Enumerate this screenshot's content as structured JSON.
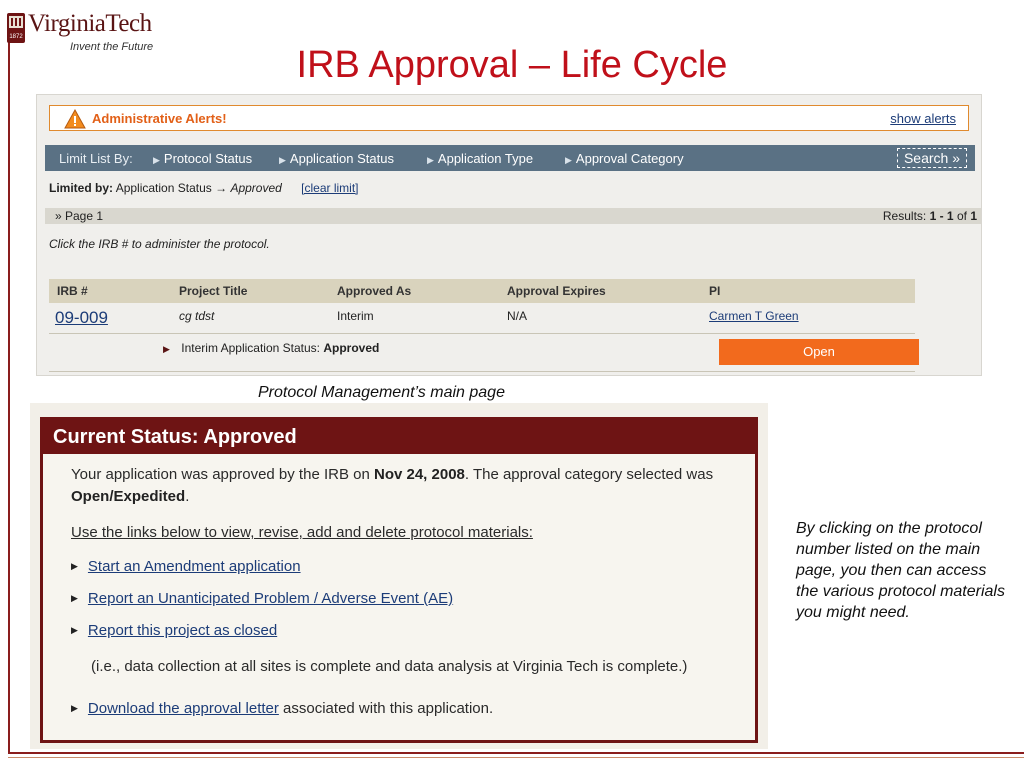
{
  "logo": {
    "wordmark": "VirginiaTech",
    "tagline": "Invent the Future",
    "seal_text": "1872"
  },
  "slide": {
    "title": "IRB Approval – Life Cycle"
  },
  "alerts": {
    "label": "Administrative Alerts!",
    "show_link": "show alerts",
    "icon": "warning-triangle-icon"
  },
  "limit_bar": {
    "label": "Limit List By:",
    "filters": [
      "Protocol Status",
      "Application Status",
      "Application Type",
      "Approval Category"
    ],
    "search_label": "Search »"
  },
  "limited_by": {
    "label": "Limited by:",
    "field": "Application Status",
    "arrow": "→",
    "value": "Approved",
    "clear_link": "[clear limit]"
  },
  "pagination": {
    "page_label": "» Page 1",
    "results_prefix": "Results:",
    "results_range": "1 - 1",
    "results_of": "of",
    "results_total": "1"
  },
  "instruction": "Click the IRB # to administer the protocol.",
  "table": {
    "headers": [
      "IRB #",
      "Project Title",
      "Approved As",
      "Approval Expires",
      "PI"
    ],
    "row": {
      "irb": "09-009",
      "title": "cg tdst",
      "approved_as": "Interim",
      "expires": "N/A",
      "pi": "Carmen T Green"
    },
    "sub_row_label": "Interim Application Status:",
    "sub_row_value": "Approved",
    "open_button": "Open"
  },
  "caption_top": "Protocol Management’s main page",
  "status": {
    "header": "Current Status: Approved",
    "body_pre": "Your application was approved by the IRB on ",
    "body_date": "Nov 24, 2008",
    "body_mid": ". The approval category selected was ",
    "body_category": "Open/Expedited",
    "body_end": ".",
    "use_links": "Use the links below to view, revise, add and delete protocol materials:",
    "links": [
      "Start an Amendment application",
      "Report an Unanticipated Problem / Adverse Event (AE)",
      "Report this project as closed"
    ],
    "closed_note": "(i.e., data collection at all sites is complete and data analysis at Virginia Tech is complete.)",
    "download_link": "Download the approval letter",
    "download_suffix": " associated with this application."
  },
  "side_note": "By clicking on the protocol number listed on the main page, you then can access the various protocol materials you might need.",
  "colors": {
    "title_red": "#c0101a",
    "maroon": "#6e1414",
    "orange": "#f26a1d",
    "bar_slate": "#5a7184",
    "link_blue": "#1c3c78"
  }
}
